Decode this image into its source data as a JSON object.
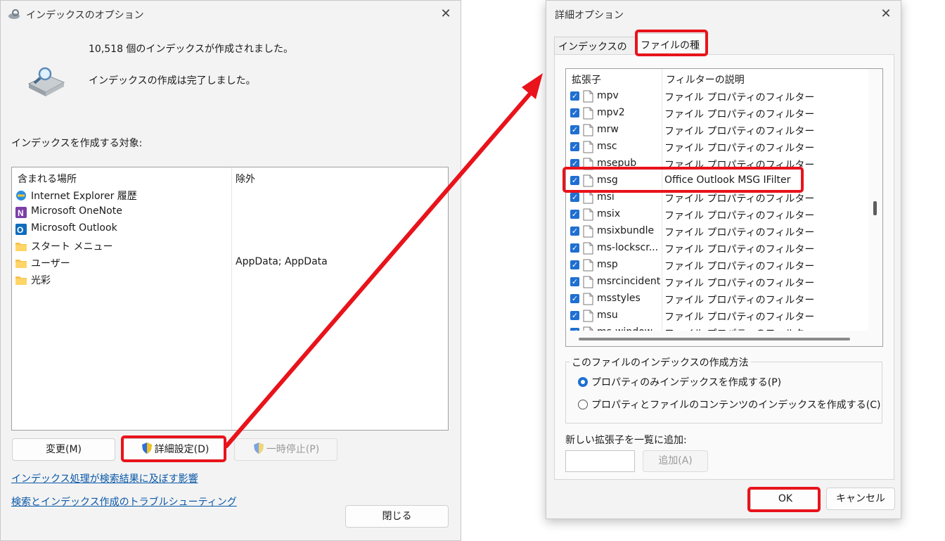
{
  "indexing_options": {
    "title": "インデックスのオプション",
    "count_text": "10,518 個のインデックスが作成されました。",
    "status_text": "インデックスの作成は完了しました。",
    "target_label": "インデックスを作成する対象:",
    "columns": {
      "included": "含まれる場所",
      "excluded": "除外"
    },
    "locations": [
      {
        "name": "Internet Explorer 履歴",
        "icon": "ie-icon",
        "exclude": ""
      },
      {
        "name": "Microsoft OneNote",
        "icon": "onenote-icon",
        "exclude": ""
      },
      {
        "name": "Microsoft Outlook",
        "icon": "outlook-icon",
        "exclude": ""
      },
      {
        "name": "スタート メニュー",
        "icon": "folder-icon",
        "exclude": ""
      },
      {
        "name": "ユーザー",
        "icon": "folder-icon",
        "exclude": "AppData; AppData"
      },
      {
        "name": "光彩",
        "icon": "folder-icon",
        "exclude": ""
      }
    ],
    "buttons": {
      "modify": "変更(M)",
      "advanced": "詳細設定(D)",
      "pause": "一時停止(P)",
      "close": "閉じる"
    },
    "links": {
      "effect": "インデックス処理が検索結果に及ぼす影響",
      "troubleshoot": "検索とインデックス作成のトラブルシューティング"
    }
  },
  "advanced_options": {
    "title": "詳細オプション",
    "tabs": [
      "インデックスの設定",
      "ファイルの種類"
    ],
    "active_tab": "ファイルの種類",
    "columns": {
      "ext": "拡張子",
      "desc": "フィルターの説明"
    },
    "file_types": [
      {
        "ext": "mpv",
        "desc": "ファイル プロパティのフィルター",
        "checked": true
      },
      {
        "ext": "mpv2",
        "desc": "ファイル プロパティのフィルター",
        "checked": true
      },
      {
        "ext": "mrw",
        "desc": "ファイル プロパティのフィルター",
        "checked": true
      },
      {
        "ext": "msc",
        "desc": "ファイル プロパティのフィルター",
        "checked": true
      },
      {
        "ext": "msepub",
        "desc": "ファイル プロパティのフィルター",
        "checked": true
      },
      {
        "ext": "msg",
        "desc": "Office Outlook MSG IFilter",
        "checked": true
      },
      {
        "ext": "msi",
        "desc": "ファイル プロパティのフィルター",
        "checked": true
      },
      {
        "ext": "msix",
        "desc": "ファイル プロパティのフィルター",
        "checked": true
      },
      {
        "ext": "msixbundle",
        "desc": "ファイル プロパティのフィルター",
        "checked": true
      },
      {
        "ext": "ms-lockscr...",
        "desc": "ファイル プロパティのフィルター",
        "checked": true
      },
      {
        "ext": "msp",
        "desc": "ファイル プロパティのフィルター",
        "checked": true
      },
      {
        "ext": "msrcincident",
        "desc": "ファイル プロパティのフィルター",
        "checked": true
      },
      {
        "ext": "msstyles",
        "desc": "ファイル プロパティのフィルター",
        "checked": true
      },
      {
        "ext": "msu",
        "desc": "ファイル プロパティのフィルター",
        "checked": true
      },
      {
        "ext": "ms-window...",
        "desc": "ファイル プロパティのフィルター",
        "checked": true
      }
    ],
    "group_label": "このファイルのインデックスの作成方法",
    "radio_options": [
      {
        "label": "プロパティのみインデックスを作成する(P)",
        "selected": true
      },
      {
        "label": "プロパティとファイルのコンテンツのインデックスを作成する(C)",
        "selected": false
      }
    ],
    "add_label": "新しい拡張子を一覧に追加:",
    "add_input_value": "",
    "buttons": {
      "add": "追加(A)",
      "ok": "OK",
      "cancel": "キャンセル"
    }
  },
  "colors": {
    "highlight_red": "#e8131b",
    "checkbox_blue": "#1f6fd1",
    "link_blue": "#0a58a8"
  }
}
